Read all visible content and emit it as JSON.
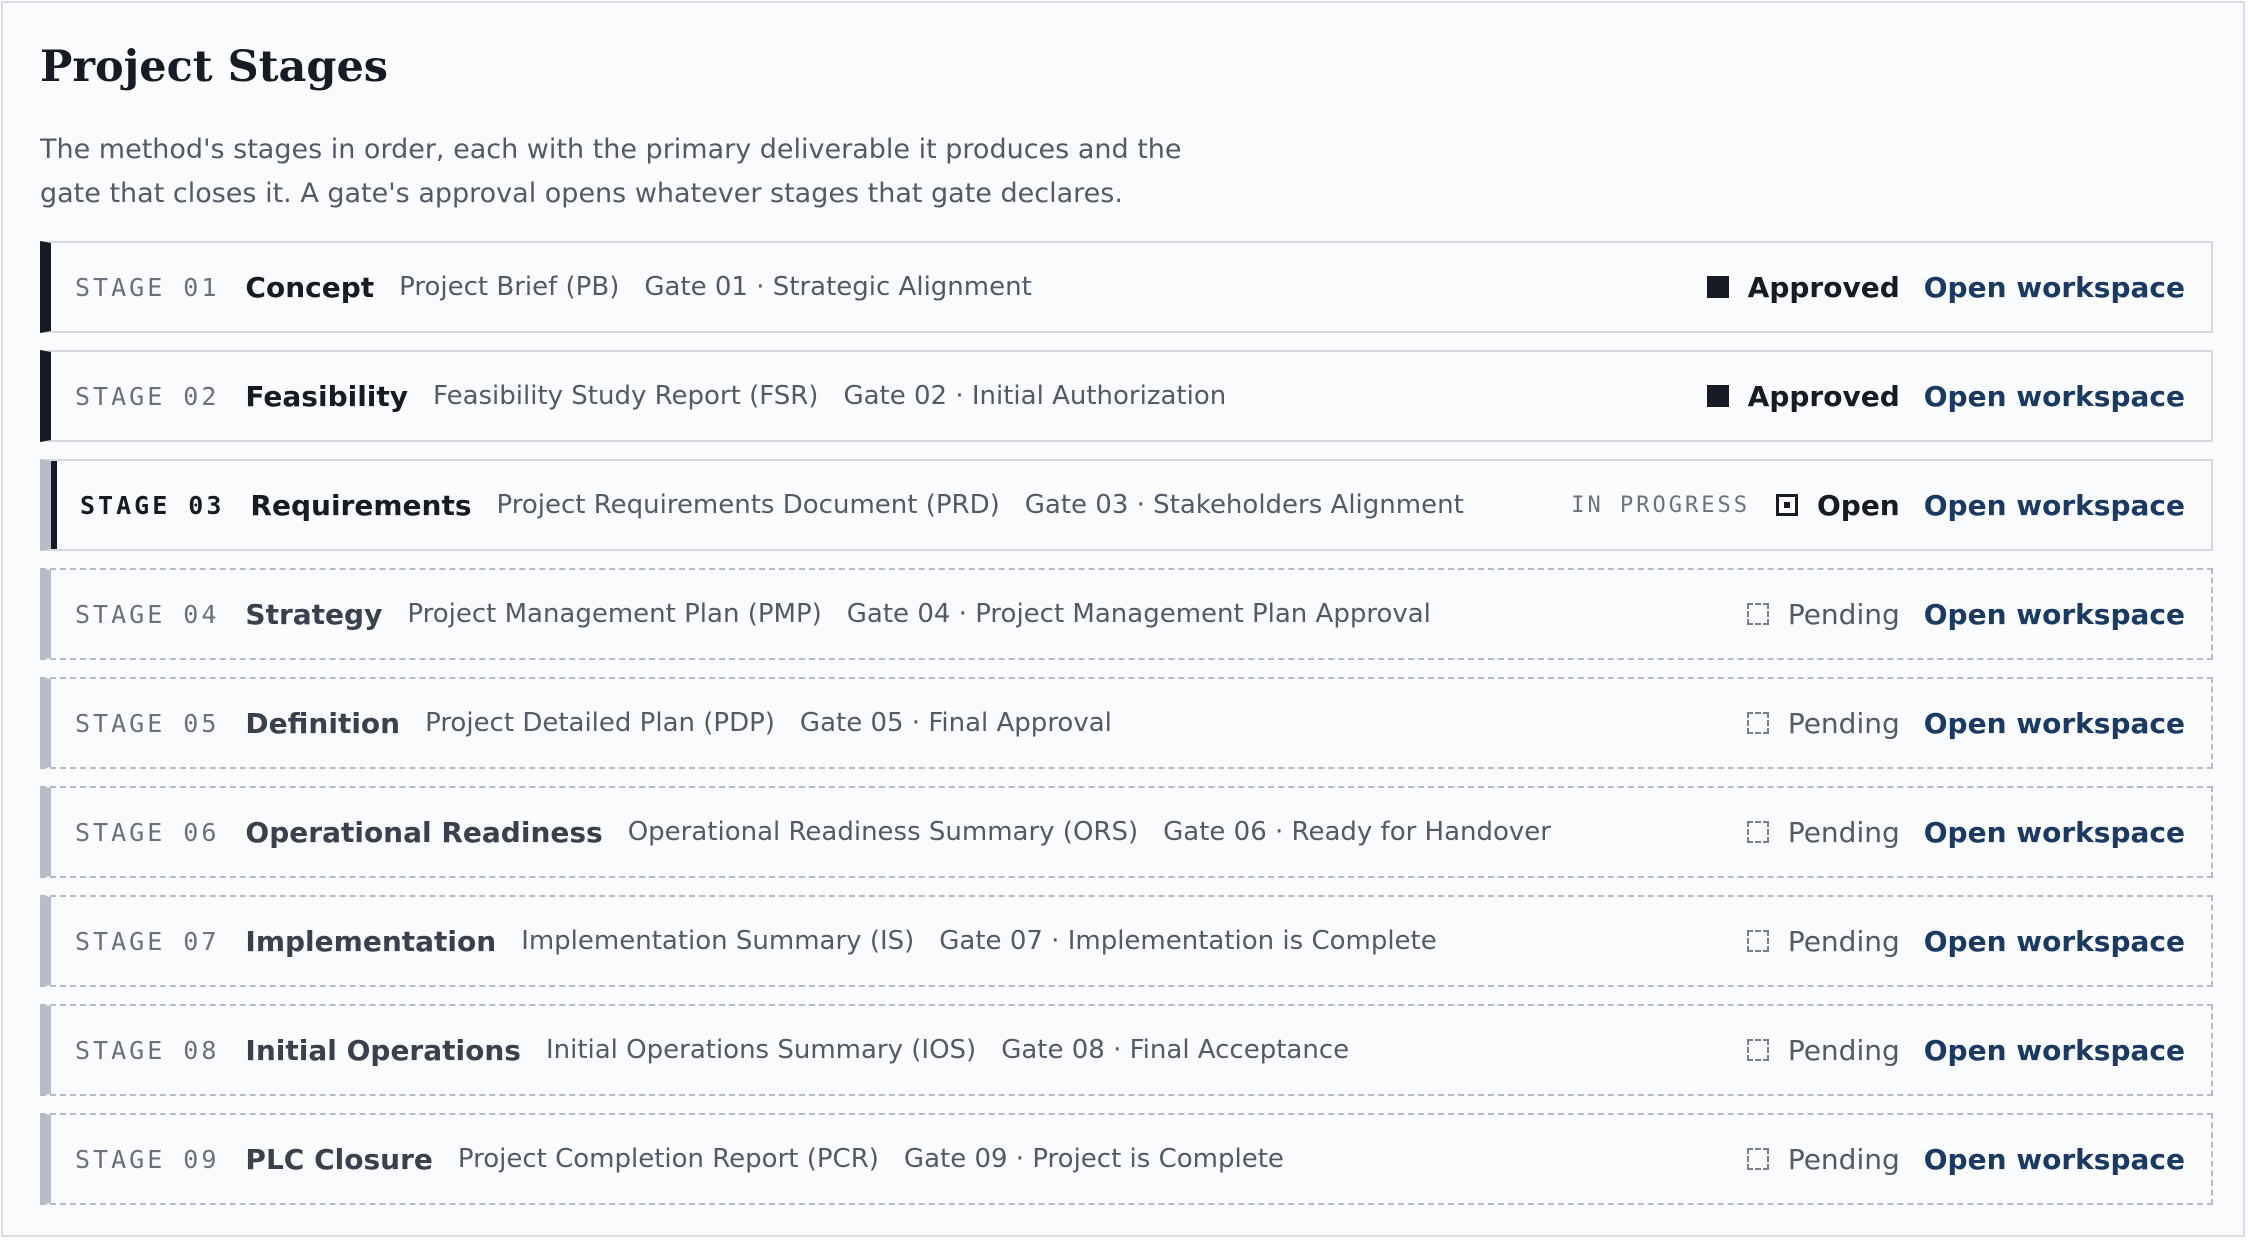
{
  "page": {
    "title": "Project Stages",
    "description": "The method's stages in order, each with the primary deliverable it produces and the gate that closes it. A gate's approval opens whatever stages that gate declares."
  },
  "colors": {
    "ink": "#161b24",
    "muted": "#535a66",
    "link": "#1b3a63",
    "pending_bar": "#b7bdc6"
  },
  "in_progress_label": "IN PROGRESS",
  "stages": [
    {
      "number": "STAGE 01",
      "name": "Concept",
      "deliverable": "Project Brief (PB)",
      "gate": "Gate 01 · Strategic Alignment",
      "state": "approved",
      "status_icon": "filled-square-icon",
      "status_label": "Approved",
      "action": "Open workspace"
    },
    {
      "number": "STAGE 02",
      "name": "Feasibility",
      "deliverable": "Feasibility Study Report (FSR)",
      "gate": "Gate 02 · Initial Authorization",
      "state": "approved",
      "status_icon": "filled-square-icon",
      "status_label": "Approved",
      "action": "Open workspace"
    },
    {
      "number": "STAGE 03",
      "name": "Requirements",
      "deliverable": "Project Requirements Document (PRD)",
      "gate": "Gate 03 · Stakeholders Alignment",
      "state": "progress",
      "status_icon": "open-square-icon",
      "status_label": "Open",
      "action": "Open workspace"
    },
    {
      "number": "STAGE 04",
      "name": "Strategy",
      "deliverable": "Project Management Plan (PMP)",
      "gate": "Gate 04 · Project Management Plan Approval",
      "state": "pending",
      "status_icon": "dashed-square-icon",
      "status_label": "Pending",
      "action": "Open workspace"
    },
    {
      "number": "STAGE 05",
      "name": "Definition",
      "deliverable": "Project Detailed Plan (PDP)",
      "gate": "Gate 05 · Final Approval",
      "state": "pending",
      "status_icon": "dashed-square-icon",
      "status_label": "Pending",
      "action": "Open workspace"
    },
    {
      "number": "STAGE 06",
      "name": "Operational Readiness",
      "deliverable": "Operational Readiness Summary (ORS)",
      "gate": "Gate 06 · Ready for Handover",
      "state": "pending",
      "status_icon": "dashed-square-icon",
      "status_label": "Pending",
      "action": "Open workspace"
    },
    {
      "number": "STAGE 07",
      "name": "Implementation",
      "deliverable": "Implementation Summary (IS)",
      "gate": "Gate 07 · Implementation is Complete",
      "state": "pending",
      "status_icon": "dashed-square-icon",
      "status_label": "Pending",
      "action": "Open workspace"
    },
    {
      "number": "STAGE 08",
      "name": "Initial Operations",
      "deliverable": "Initial Operations Summary (IOS)",
      "gate": "Gate 08 · Final Acceptance",
      "state": "pending",
      "status_icon": "dashed-square-icon",
      "status_label": "Pending",
      "action": "Open workspace"
    },
    {
      "number": "STAGE 09",
      "name": "PLC Closure",
      "deliverable": "Project Completion Report (PCR)",
      "gate": "Gate 09 · Project is Complete",
      "state": "pending",
      "status_icon": "dashed-square-icon",
      "status_label": "Pending",
      "action": "Open workspace"
    }
  ]
}
